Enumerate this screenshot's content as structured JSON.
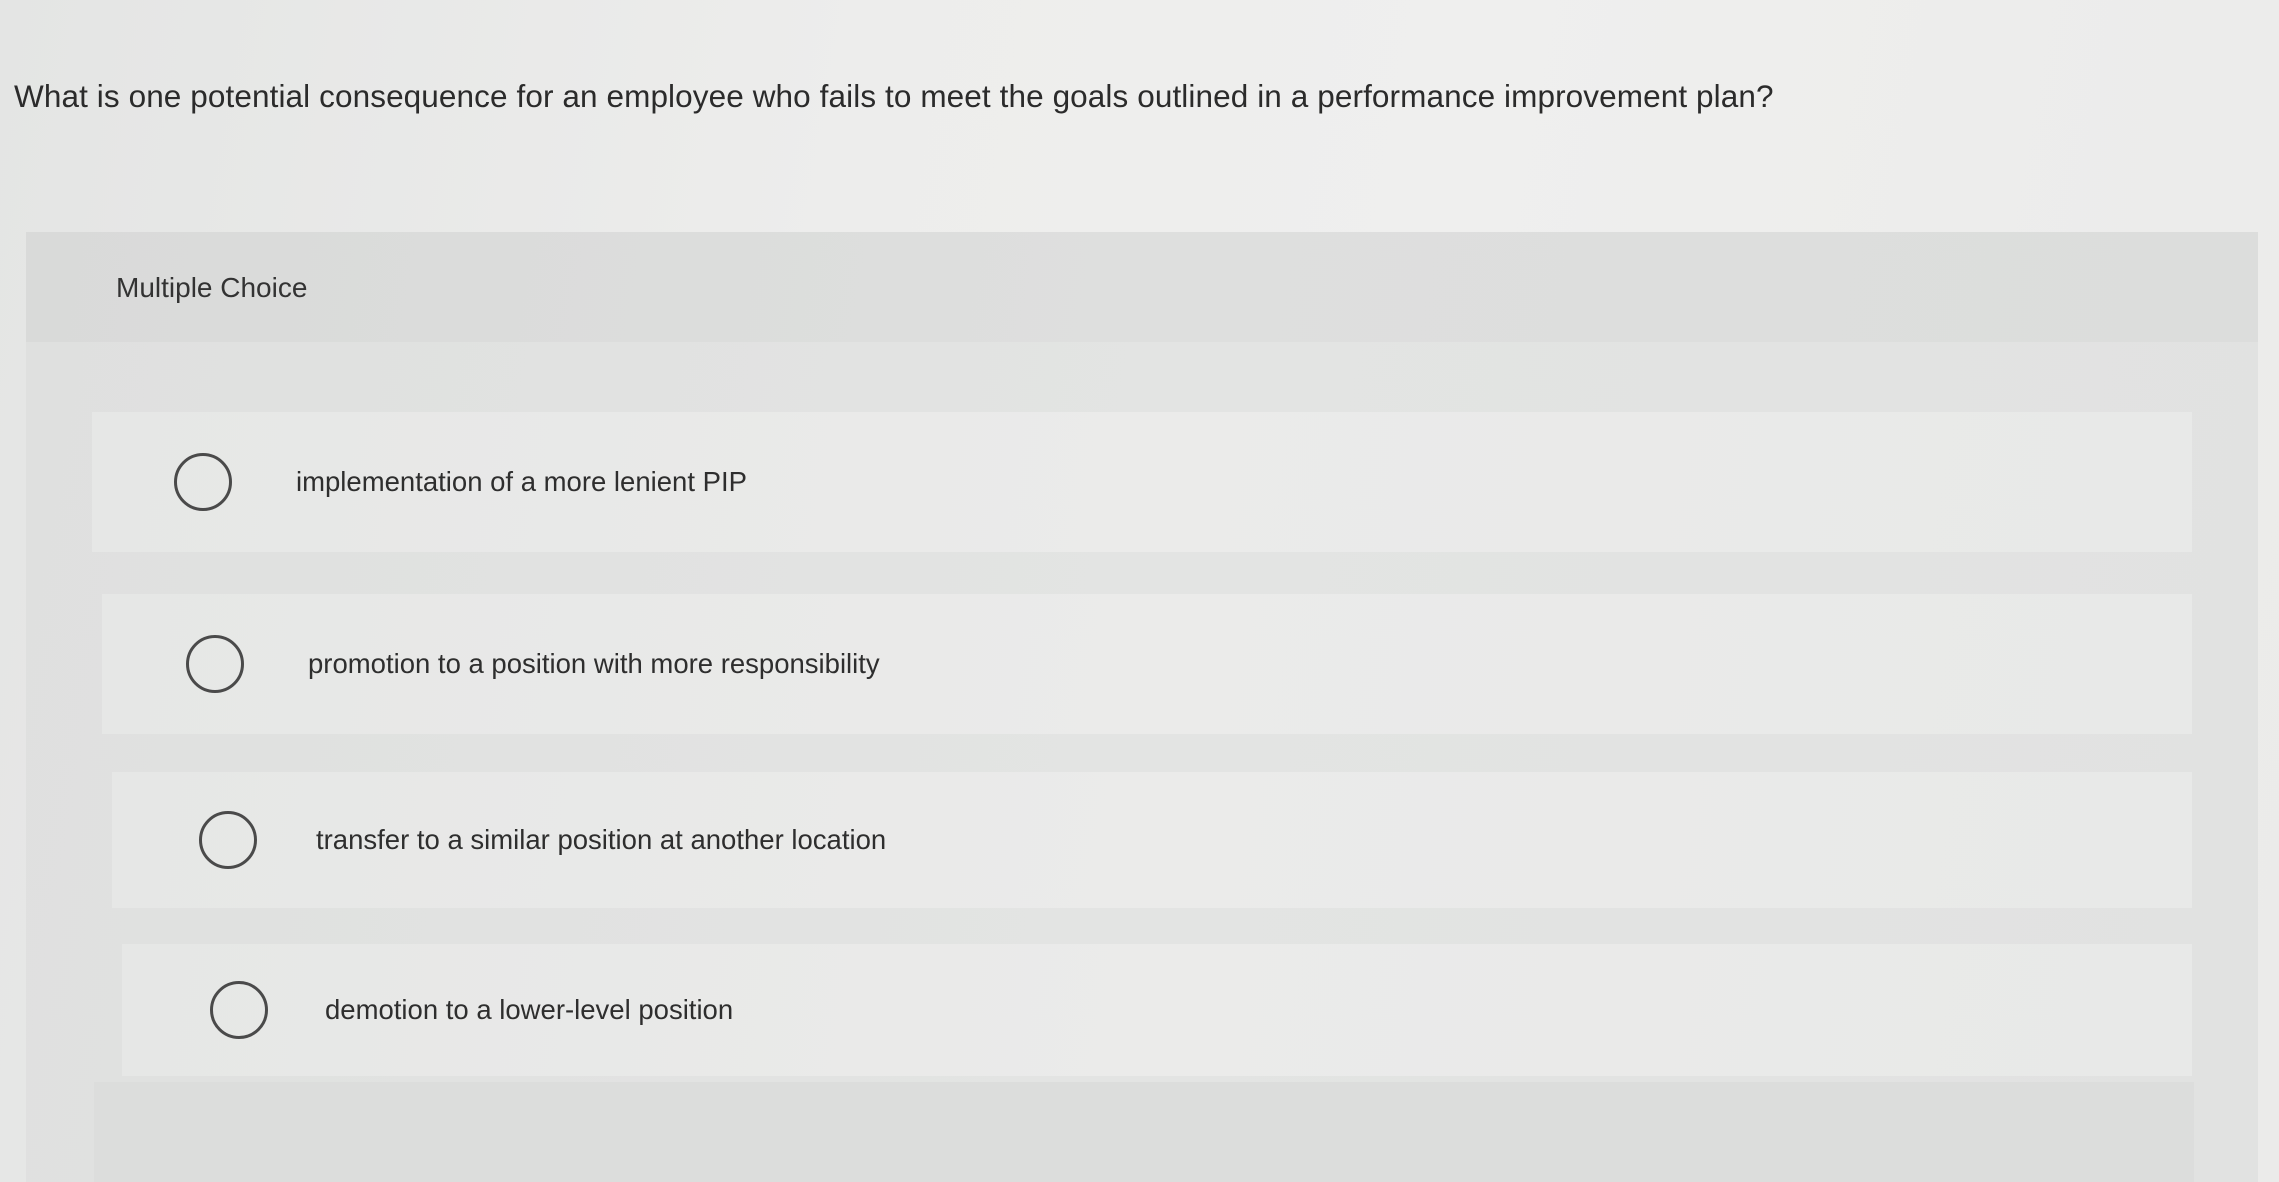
{
  "question": {
    "text": "What is one potential consequence for an employee who fails to meet the goals outlined in a performance improvement plan?"
  },
  "answer_panel": {
    "title": "Multiple Choice",
    "options": [
      {
        "label": "implementation of a more lenient PIP",
        "selected": false
      },
      {
        "label": "promotion to a position with more responsibility",
        "selected": false
      },
      {
        "label": "transfer to a similar position at another location",
        "selected": false
      },
      {
        "label": "demotion to a lower-level position",
        "selected": false
      }
    ]
  },
  "icons": {
    "radio": "radio-button-unchecked-icon"
  }
}
